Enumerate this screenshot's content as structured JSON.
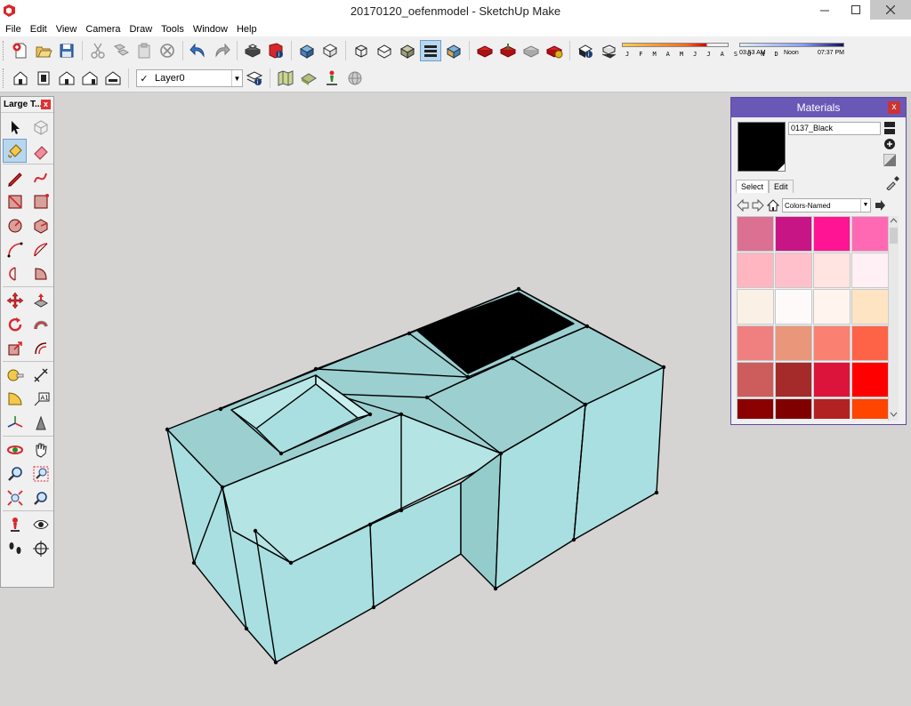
{
  "window": {
    "title": "20170120_oefenmodel - SketchUp Make",
    "icons": [
      "sketchup-logo-icon",
      "minimize-icon",
      "maximize-icon",
      "close-icon"
    ]
  },
  "menu": [
    "File",
    "Edit",
    "View",
    "Camera",
    "Draw",
    "Tools",
    "Window",
    "Help"
  ],
  "toolbar": {
    "layer": {
      "current": "Layer0",
      "checked": "✓"
    },
    "shadow": {
      "months": "J F M A M J J A S O N D",
      "time_start": "03:53 AM",
      "time_mid": "Noon",
      "time_end": "07:37 PM"
    }
  },
  "palette": {
    "title": "Large T...",
    "close": "x"
  },
  "materials": {
    "title": "Materials",
    "close": "x",
    "selected_name": "0137_Black",
    "selected_color": "#000000",
    "tabs": [
      "Select",
      "Edit"
    ],
    "library": "Colors-Named",
    "swatches": [
      "#db7093",
      "#c71585",
      "#ff1493",
      "#ff69b4",
      "#ffb6c1",
      "#ffc0cb",
      "#ffe4e1",
      "#fff0f5",
      "#faf0e6",
      "#fffafa",
      "#fff5ee",
      "#ffe4c4",
      "#f08080",
      "#e9967a",
      "#fa8072",
      "#ff6347",
      "#cd5c5c",
      "#a52a2a",
      "#dc143c",
      "#ff0000",
      "#8b0000",
      "#800000",
      "#b22222",
      "#ff4500"
    ]
  },
  "model": {
    "face_color": "#a9dfe0",
    "face_shade": "#94cccc",
    "top_color": "#9ccfd0",
    "edge_color": "#000000",
    "black_material": "#000000"
  }
}
